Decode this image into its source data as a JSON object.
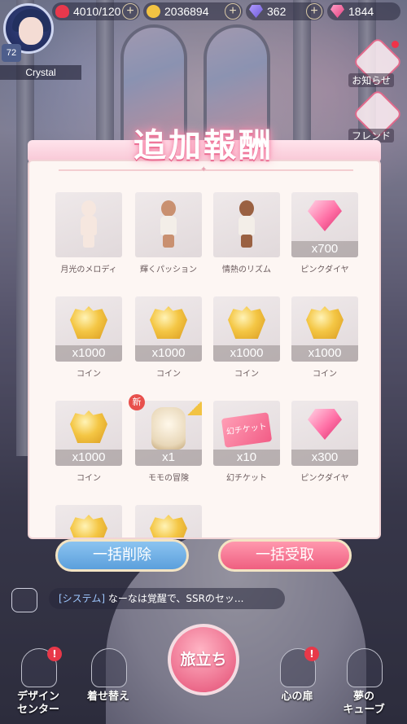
{
  "status_bar": {
    "stamina": "4010/120",
    "coins": "2036894",
    "purple_gems": "362",
    "pink_gems": "1844",
    "icons": [
      "heart-icon",
      "coin-icon",
      "purple-gem-icon",
      "pink-gem-icon"
    ]
  },
  "player": {
    "name": "Crystal",
    "level": "72"
  },
  "side_menu": {
    "notice_label": "お知らせ",
    "friend_label": "フレンド"
  },
  "dialog": {
    "title": "追加報酬",
    "rewards": [
      {
        "name": "月光のメロディ",
        "qty": "",
        "kind": "doll-light"
      },
      {
        "name": "輝くパッション",
        "qty": "",
        "kind": "doll-tan"
      },
      {
        "name": "情熱のリズム",
        "qty": "",
        "kind": "doll-dark"
      },
      {
        "name": "ピンクダイヤ",
        "qty": "x700",
        "kind": "diamond"
      },
      {
        "name": "コイン",
        "qty": "x1000",
        "kind": "coin"
      },
      {
        "name": "コイン",
        "qty": "x1000",
        "kind": "coin"
      },
      {
        "name": "コイン",
        "qty": "x1000",
        "kind": "coin"
      },
      {
        "name": "コイン",
        "qty": "x1000",
        "kind": "coin"
      },
      {
        "name": "コイン",
        "qty": "x1000",
        "kind": "coin"
      },
      {
        "name": "モモの冒険",
        "qty": "x1",
        "kind": "backpack",
        "badge": "新"
      },
      {
        "name": "幻チケット",
        "qty": "x10",
        "kind": "ticket",
        "ticket_text": "幻チケット"
      },
      {
        "name": "ピンクダイヤ",
        "qty": "x300",
        "kind": "diamond"
      },
      {
        "name": "",
        "qty": "",
        "kind": "coin"
      },
      {
        "name": "",
        "qty": "",
        "kind": "coin"
      }
    ],
    "delete_all_label": "一括削除",
    "receive_all_label": "一括受取"
  },
  "chat": {
    "tag": "[システム]",
    "message": "なーなは覚醒で、SSRのセッ..."
  },
  "bottom_nav": {
    "design_center": "デザイン\nセンター",
    "dress_up": "着せ替え",
    "journey": "旅立ち",
    "heart_door": "心の扉",
    "dream_cube": "夢の\nキューブ"
  },
  "colors": {
    "accent_pink": "#ef5f80",
    "accent_blue": "#5b9fdc",
    "title_glow": "#f07da0"
  }
}
